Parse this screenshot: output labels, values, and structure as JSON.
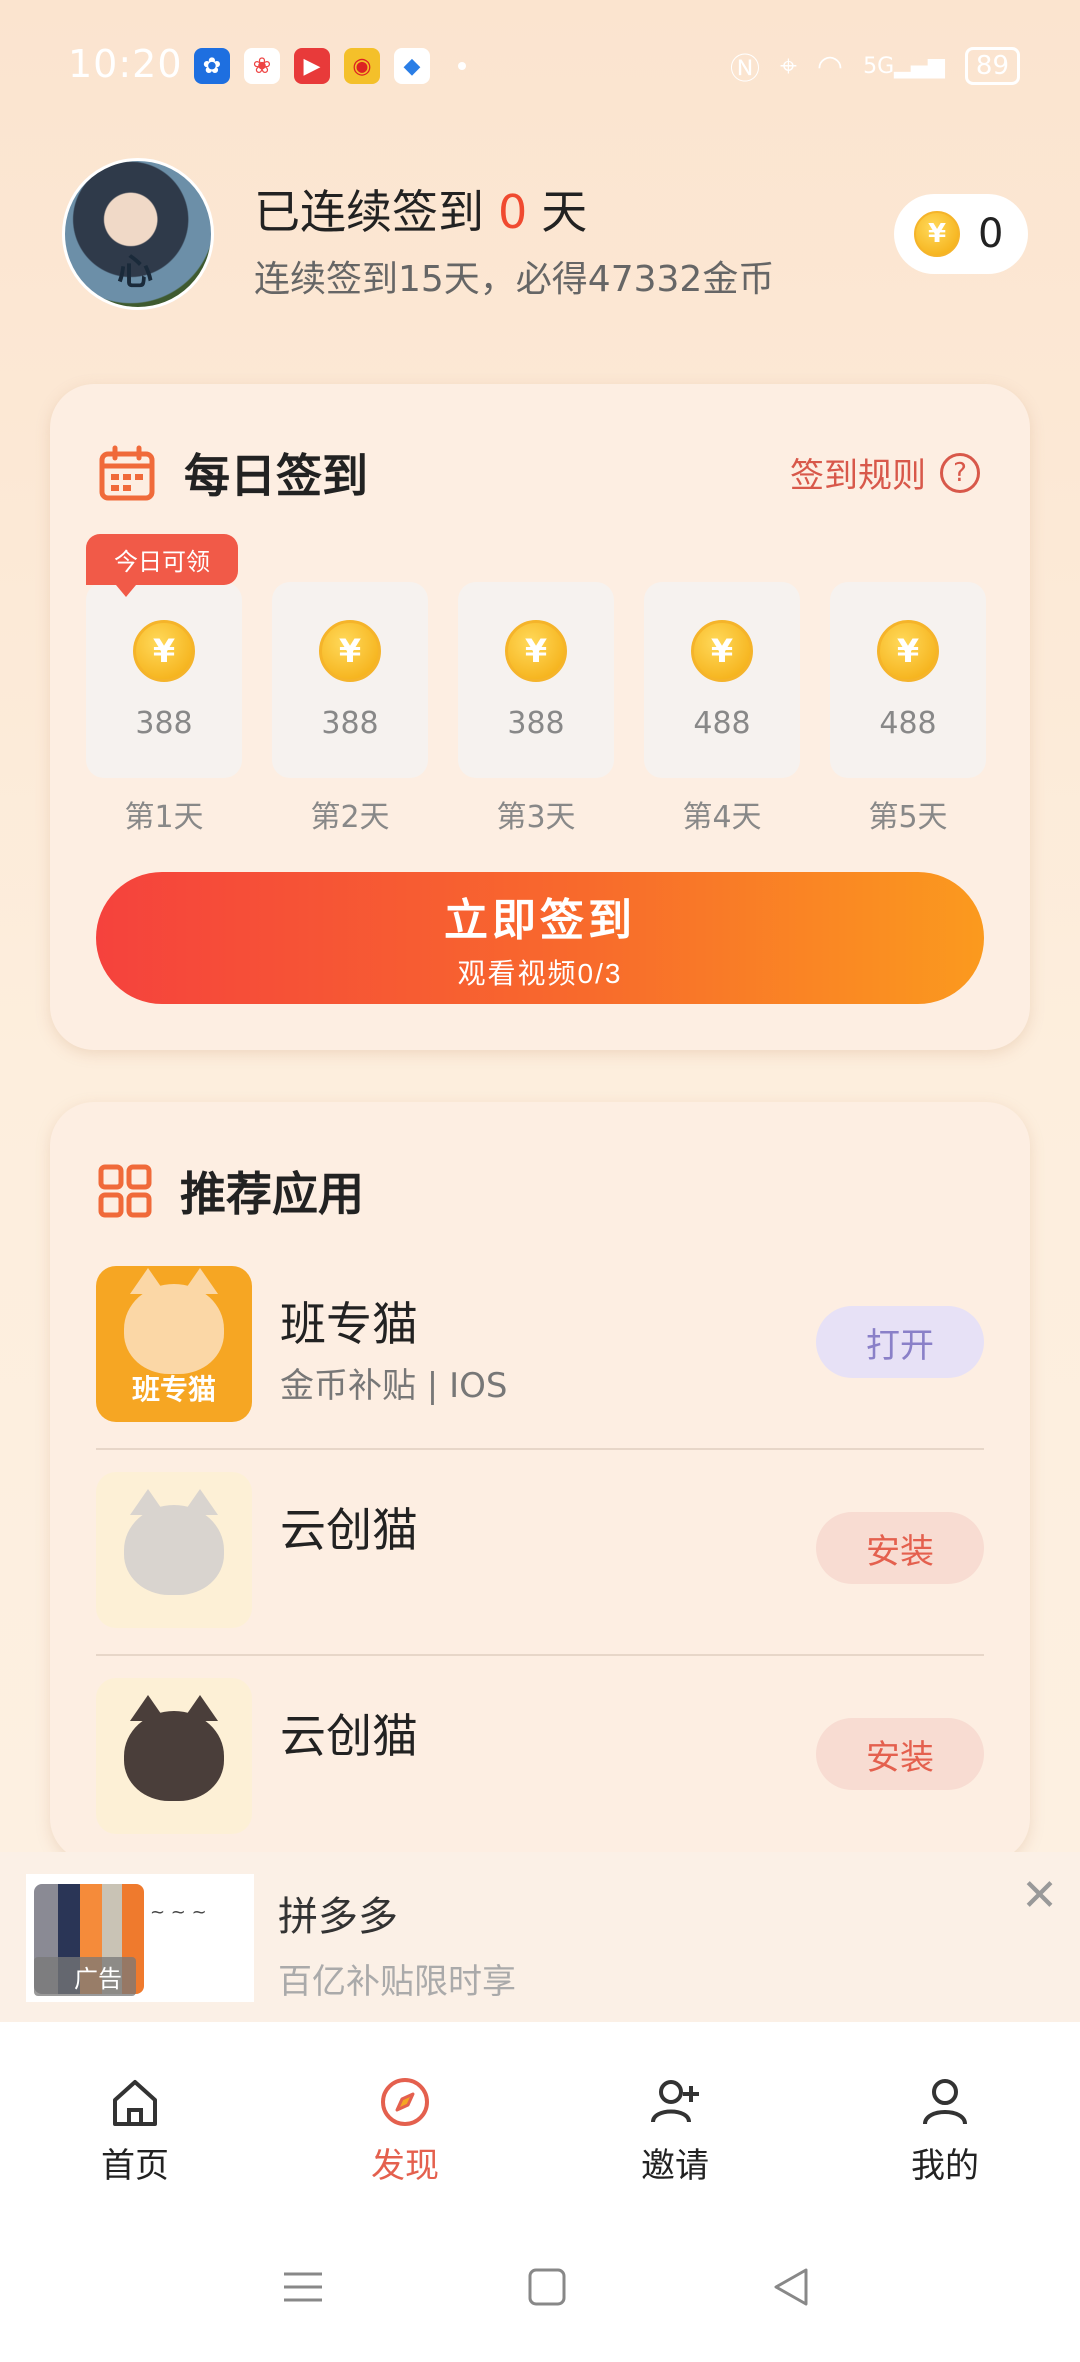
{
  "status_bar": {
    "time": "10:20",
    "network": "5G",
    "battery": "89"
  },
  "header": {
    "avatar_text": "心",
    "signin_prefix": "已连续签到",
    "signin_days": "0",
    "signin_suffix": "天",
    "subtitle": "连续签到15天，必得47332金币",
    "coin_balance": "0",
    "coin_symbol": "¥"
  },
  "daily": {
    "title": "每日签到",
    "rules_label": "签到规则",
    "rules_icon": "?",
    "today_tag": "今日可领",
    "days": [
      {
        "amount": "388",
        "label": "第1天"
      },
      {
        "amount": "388",
        "label": "第2天"
      },
      {
        "amount": "388",
        "label": "第3天"
      },
      {
        "amount": "488",
        "label": "第4天"
      },
      {
        "amount": "488",
        "label": "第5天"
      }
    ],
    "button_main": "立即签到",
    "button_sub": "观看视频0/3"
  },
  "apps": {
    "title": "推荐应用",
    "items": [
      {
        "name": "班专猫",
        "desc": "金币补贴 | IOS",
        "icon_text": "班专猫",
        "action": "打开"
      },
      {
        "name": "云创猫",
        "desc": "",
        "action": "安装"
      },
      {
        "name": "云创猫",
        "desc": "",
        "action": "安装"
      }
    ]
  },
  "ad": {
    "title": "拼多多",
    "subtitle": "百亿补贴限时享",
    "tag": "广告",
    "close": "✕"
  },
  "nav": {
    "items": [
      {
        "label": "首页"
      },
      {
        "label": "发现"
      },
      {
        "label": "邀请"
      },
      {
        "label": "我的"
      }
    ],
    "active_index": 1
  },
  "colors": {
    "accent": "#f04a30",
    "button_gradient_start": "#f5423d",
    "button_gradient_end": "#fb9a1e",
    "coin": "#f3a90c"
  }
}
